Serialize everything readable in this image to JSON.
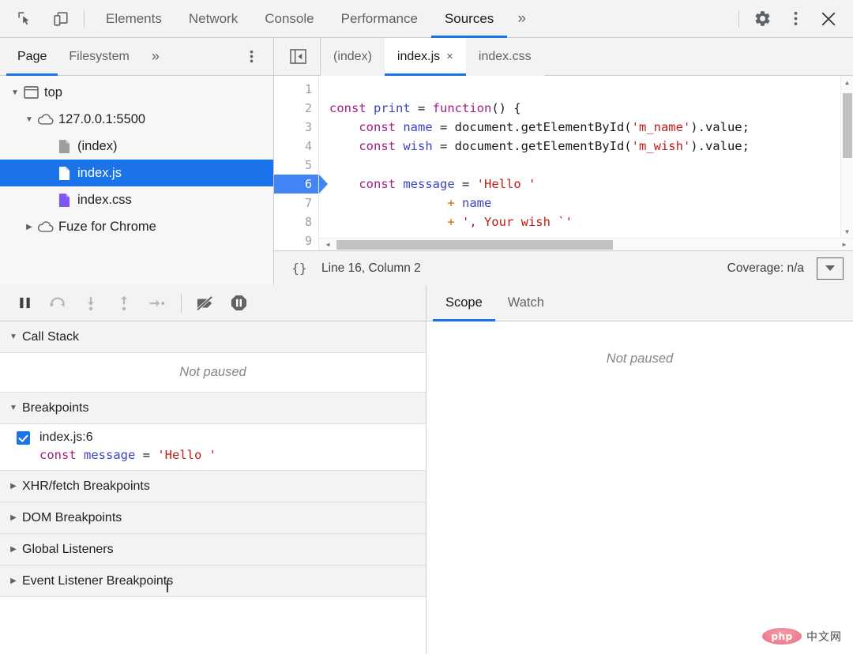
{
  "devtools": {
    "main_tabs": [
      {
        "label": "Elements",
        "active": false
      },
      {
        "label": "Network",
        "active": false
      },
      {
        "label": "Console",
        "active": false
      },
      {
        "label": "Performance",
        "active": false
      },
      {
        "label": "Sources",
        "active": true
      }
    ],
    "more_tabs_label": "»",
    "icons": {
      "inspect": "inspect-element-icon",
      "device": "device-toolbar-icon",
      "settings": "gear-icon",
      "more": "kebab-menu-icon",
      "close": "close-icon"
    }
  },
  "navigator": {
    "tabs": [
      {
        "label": "Page",
        "active": true
      },
      {
        "label": "Filesystem",
        "active": false
      }
    ],
    "more_label": "»",
    "tree": [
      {
        "label": "top",
        "icon": "frame-icon",
        "depth": 0,
        "twisty": "open",
        "selected": false
      },
      {
        "label": "127.0.0.1:5500",
        "icon": "cloud-icon",
        "depth": 1,
        "twisty": "open",
        "selected": false
      },
      {
        "label": "(index)",
        "icon": "document-icon-grey",
        "depth": 2,
        "twisty": "none",
        "selected": false
      },
      {
        "label": "index.js",
        "icon": "document-icon-white",
        "depth": 2,
        "twisty": "none",
        "selected": true
      },
      {
        "label": "index.css",
        "icon": "document-icon-purple",
        "depth": 2,
        "twisty": "none",
        "selected": false
      },
      {
        "label": "Fuze for Chrome",
        "icon": "cloud-icon",
        "depth": 1,
        "twisty": "closed",
        "selected": false
      }
    ]
  },
  "editor": {
    "tabs": [
      {
        "label": "(index)",
        "active": false,
        "closable": false
      },
      {
        "label": "index.js",
        "active": true,
        "closable": true
      },
      {
        "label": "index.css",
        "active": false,
        "closable": false
      }
    ],
    "close_glyph": "×",
    "line_numbers": [
      "1",
      "2",
      "3",
      "4",
      "5",
      "6",
      "7",
      "8",
      "9"
    ],
    "breakpoint_line": "6",
    "lines": [
      [],
      [
        {
          "t": "const ",
          "c": "k"
        },
        {
          "t": "print",
          "c": "vn"
        },
        {
          "t": " = ",
          "c": "pl"
        },
        {
          "t": "function",
          "c": "k"
        },
        {
          "t": "() {",
          "c": "pl"
        }
      ],
      [
        {
          "t": "    ",
          "c": "pl"
        },
        {
          "t": "const ",
          "c": "k"
        },
        {
          "t": "name",
          "c": "vn"
        },
        {
          "t": " = document.getElementById(",
          "c": "pl"
        },
        {
          "t": "'m_name'",
          "c": "st"
        },
        {
          "t": ").value;",
          "c": "pl"
        }
      ],
      [
        {
          "t": "    ",
          "c": "pl"
        },
        {
          "t": "const ",
          "c": "k"
        },
        {
          "t": "wish",
          "c": "vn"
        },
        {
          "t": " = document.getElementById(",
          "c": "pl"
        },
        {
          "t": "'m_wish'",
          "c": "st"
        },
        {
          "t": ").value;",
          "c": "pl"
        }
      ],
      [],
      [
        {
          "t": "    ",
          "c": "pl"
        },
        {
          "t": "const ",
          "c": "k"
        },
        {
          "t": "message",
          "c": "vn"
        },
        {
          "t": " = ",
          "c": "pl"
        },
        {
          "t": "'Hello '",
          "c": "st"
        }
      ],
      [
        {
          "t": "                ",
          "c": "pl"
        },
        {
          "t": "+ ",
          "c": "op"
        },
        {
          "t": "name",
          "c": "vn"
        }
      ],
      [
        {
          "t": "                ",
          "c": "pl"
        },
        {
          "t": "+ ",
          "c": "op"
        },
        {
          "t": "', Your wish `'",
          "c": "st"
        }
      ],
      []
    ],
    "status": {
      "format_icon_label": "{}",
      "cursor_position": "Line 16, Column 2",
      "coverage": "Coverage: n/a",
      "coverage_icon": "coverage-drawer-icon"
    }
  },
  "debugger": {
    "toolbar": [
      {
        "name": "resume-script-execution",
        "icon": "pause-icon"
      },
      {
        "name": "step-over-next-function-call",
        "icon": "step-over-icon"
      },
      {
        "name": "step-into-next-function-call",
        "icon": "step-into-icon"
      },
      {
        "name": "step-out-of-current-function",
        "icon": "step-out-icon"
      },
      {
        "name": "step",
        "icon": "step-icon"
      },
      {
        "name": "deactivate-breakpoints",
        "icon": "deactivate-breakpoints-icon"
      },
      {
        "name": "pause-on-exceptions",
        "icon": "pause-on-exceptions-icon"
      }
    ],
    "sections": [
      {
        "title": "Call Stack",
        "expanded": true,
        "empty_text": "Not paused"
      },
      {
        "title": "Breakpoints",
        "expanded": true
      },
      {
        "title": "XHR/fetch Breakpoints",
        "expanded": false
      },
      {
        "title": "DOM Breakpoints",
        "expanded": false
      },
      {
        "title": "Global Listeners",
        "expanded": false
      },
      {
        "title": "Event Listener Breakpoints",
        "expanded": false
      }
    ],
    "breakpoints": [
      {
        "location": "index.js:6",
        "snippet": "const message = 'Hello '",
        "checked": true
      }
    ],
    "side_tabs": [
      {
        "label": "Scope",
        "active": true
      },
      {
        "label": "Watch",
        "active": false
      }
    ],
    "scope_empty_text": "Not paused"
  },
  "watermark": {
    "logo_text": "php",
    "label": "中文网"
  },
  "colors": {
    "accent": "#1a73e8",
    "selection": "#1a73e8",
    "breakpoint": "#4285f4",
    "panel_bg": "#f3f3f3",
    "tree_bg": "#f7f7f7"
  }
}
